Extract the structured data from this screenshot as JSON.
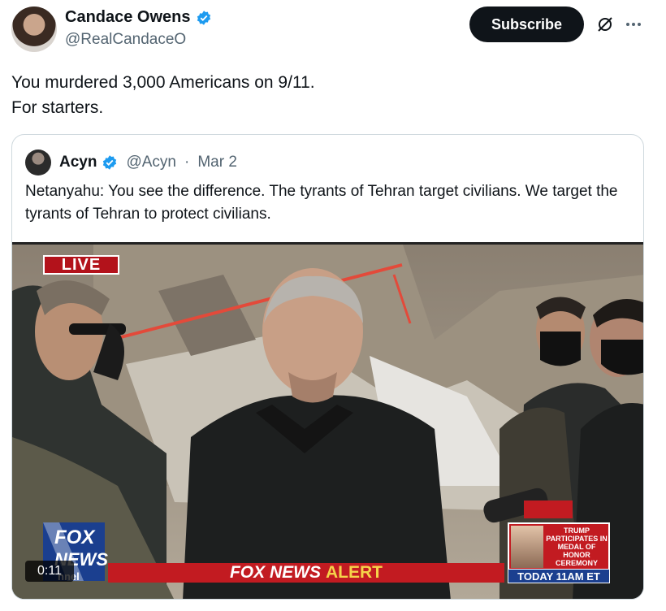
{
  "author": {
    "display_name": "Candace Owens",
    "handle": "@RealCandaceO",
    "verified_icon": "verified-badge-icon"
  },
  "actions": {
    "subscribe_label": "Subscribe",
    "grok_icon": "grok-icon",
    "more_icon": "more-icon"
  },
  "tweet": {
    "line1": "You murdered 3,000 Americans on 9/11.",
    "line2": "For starters."
  },
  "quoted": {
    "display_name": "Acyn",
    "handle": "@Acyn",
    "separator": "·",
    "date": "Mar 2",
    "text": "Netanyahu: You see the difference. The tyrants of Tehran target civilians. We target the tyrants of Tehran to protect civilians."
  },
  "video": {
    "live_label": "LIVE",
    "fox_line1": "FOX",
    "fox_line2": "NEWS",
    "channel_fragment": "nnel",
    "alert_prefix": "FOX NEWS",
    "alert_word": "ALERT",
    "promo_lines": [
      "TRUMP",
      "PARTICIPATES IN",
      "MEDAL OF HONOR",
      "CEREMONY"
    ],
    "promo_time": "TODAY 11AM ET",
    "duration": "0:11"
  },
  "colors": {
    "verified_blue": "#1d9bf0",
    "fox_red": "#c21b21",
    "alert_yellow": "#f5d34a"
  }
}
